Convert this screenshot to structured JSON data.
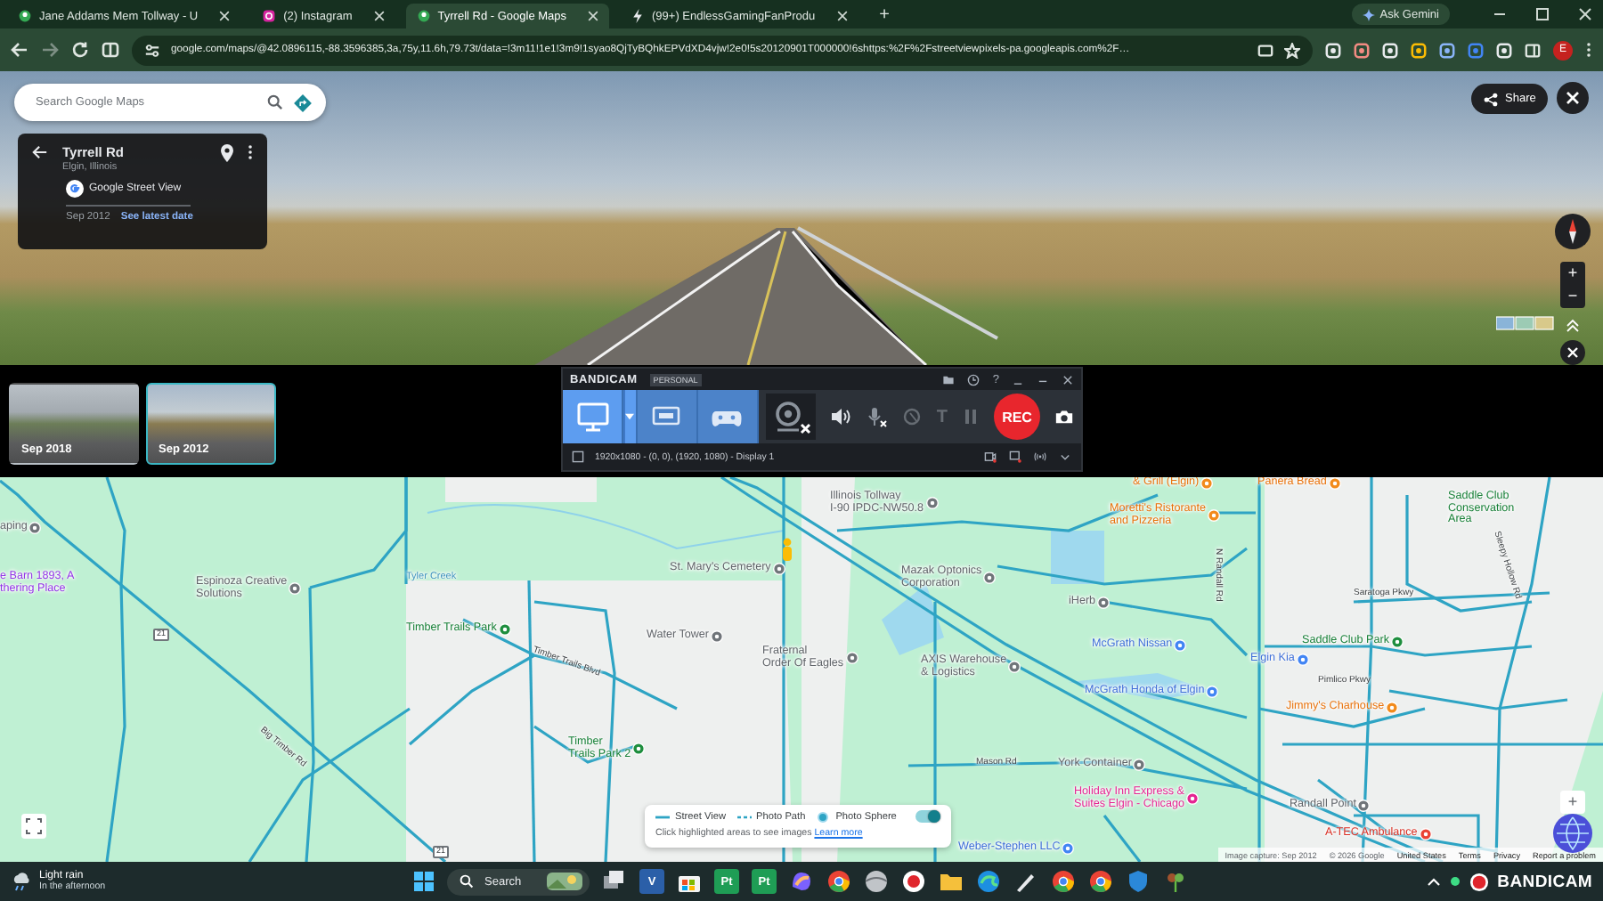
{
  "browser": {
    "tabs": [
      {
        "title": "Jane Addams Mem Tollway - U",
        "kind": "maps",
        "selected": false
      },
      {
        "title": "(2) Instagram",
        "kind": "instagram",
        "selected": false
      },
      {
        "title": "Tyrrell Rd - Google Maps",
        "kind": "maps",
        "selected": true
      },
      {
        "title": "(99+) EndlessGamingFanProdu",
        "kind": "bolt",
        "selected": false
      }
    ],
    "new_tab": "+",
    "gemini": "Ask Gemini",
    "url": "google.com/maps/@42.0896115,-88.3596385,3a,75y,11.6h,79.73t/data=!3m11!1e1!3m9!1syao8QjTyBQhkEPVdXD4vjw!2e0!5s20120901T000000!6shttps:%2F%2Fstreetviewpixels-pa.googleapis.com%2F…",
    "profile": "E"
  },
  "street_view": {
    "search": {
      "placeholder": "Search Google Maps"
    },
    "card": {
      "title": "Tyrrell Rd",
      "subtitle": "Elgin, Illinois",
      "source": "Google Street View",
      "date": "Sep 2012",
      "link": "See latest date"
    },
    "share": "Share",
    "zoom": [
      "+",
      "−"
    ],
    "timeline": [
      {
        "date": "Sep 2018",
        "selected": false
      },
      {
        "date": "Sep 2012",
        "selected": true
      }
    ]
  },
  "bandicam": {
    "brand": "BANDICAM",
    "edition": "PERSONAL",
    "help": "?",
    "modes": [
      {
        "kind": "screen",
        "selected": true
      },
      {
        "kind": "device",
        "selected": false
      },
      {
        "kind": "game",
        "selected": false
      }
    ],
    "text_tool": "T",
    "rec": "REC",
    "area": "1920x1080 - (0, 0), (1920, 1080) - Display 1"
  },
  "map": {
    "labels": [
      {
        "text": "aping",
        "kind": "place"
      },
      {
        "text": "e Barn 1893, A\nthering Place",
        "kind": "venue"
      },
      {
        "text": "Espinoza Creative\nSolutions",
        "kind": "place"
      },
      {
        "text": "Tyler Creek",
        "kind": "water"
      },
      {
        "text": "Timber Trails Park",
        "kind": "park"
      },
      {
        "text": "St. Mary's Cemetery",
        "kind": "place"
      },
      {
        "text": "Water Tower",
        "kind": "place"
      },
      {
        "text": "Fraternal\nOrder Of Eagles",
        "kind": "place"
      },
      {
        "text": "Timber\nTrails Park 2",
        "kind": "park"
      },
      {
        "text": "Illinois Tollway\nI-90 IPDC-NW50.8",
        "kind": "place"
      },
      {
        "text": "& Grill (Elgin)",
        "kind": "food"
      },
      {
        "text": "Panera Bread",
        "kind": "food"
      },
      {
        "text": "Moretti's Ristorante\nand Pizzeria",
        "kind": "food"
      },
      {
        "text": "Saddle Club\nConservation\nArea",
        "kind": "parkarea"
      },
      {
        "text": "Mazak Optonics\nCorporation",
        "kind": "place"
      },
      {
        "text": "iHerb",
        "kind": "place"
      },
      {
        "text": "McGrath Nissan",
        "kind": "auto"
      },
      {
        "text": "Saddle Club Park",
        "kind": "park"
      },
      {
        "text": "AXIS Warehouse\n& Logistics",
        "kind": "place"
      },
      {
        "text": "Elgin Kia",
        "kind": "auto"
      },
      {
        "text": "McGrath Honda of Elgin",
        "kind": "auto"
      },
      {
        "text": "Jimmy's Charhouse",
        "kind": "food"
      },
      {
        "text": "York Container",
        "kind": "place"
      },
      {
        "text": "Holiday Inn Express &\nSuites Elgin - Chicago",
        "kind": "hotel"
      },
      {
        "text": "Randall Point",
        "kind": "place"
      },
      {
        "text": "A-TEC Ambulance",
        "kind": "hospital"
      },
      {
        "text": "Big Timber Rd",
        "kind": "street"
      },
      {
        "text": "Mason Rd",
        "kind": "street"
      },
      {
        "text": "N Randall Rd",
        "kind": "street"
      },
      {
        "text": "Pimlico Pkwy",
        "kind": "street"
      },
      {
        "text": "Sleepy Hollow Rd",
        "kind": "street"
      },
      {
        "text": "Saratoga Pkwy",
        "kind": "street"
      },
      {
        "text": "Timber Trails Blvd",
        "kind": "street"
      },
      {
        "text": "21",
        "kind": "shield"
      },
      {
        "text": "21",
        "kind": "shield"
      },
      {
        "text": "Weber-Stephen LLC",
        "kind": "auto"
      }
    ],
    "legend": {
      "items": [
        {
          "label": "Street View",
          "kind": "line"
        },
        {
          "label": "Photo Path",
          "kind": "dashed"
        },
        {
          "label": "Photo Sphere",
          "kind": "dot"
        }
      ],
      "toggle_on": true,
      "hint": "Click highlighted areas to see images",
      "link": "Learn more"
    },
    "zoom": "+",
    "attribution": [
      {
        "text": "Image capture: Sep 2012",
        "link": false
      },
      {
        "text": "© 2026 Google",
        "link": false
      },
      {
        "text": "United States",
        "link": true
      },
      {
        "text": "Terms",
        "link": true
      },
      {
        "text": "Privacy",
        "link": true
      },
      {
        "text": "Report a problem",
        "link": true
      }
    ]
  },
  "taskbar": {
    "weather": {
      "title": "Light rain",
      "subtitle": "In the afternoon"
    },
    "search": {
      "placeholder": "Search"
    },
    "apps": [
      {
        "kind": "task-view"
      },
      {
        "kind": "letter",
        "label": "V",
        "color": "#2b5fa8"
      },
      {
        "kind": "store"
      },
      {
        "kind": "letter",
        "label": "Pt",
        "color": "#1f9d55"
      },
      {
        "kind": "letter",
        "label": "Pt",
        "color": "#1f9d55"
      },
      {
        "kind": "copilot"
      },
      {
        "kind": "chrome"
      },
      {
        "kind": "sphere"
      },
      {
        "kind": "record"
      },
      {
        "kind": "folder"
      },
      {
        "kind": "edge"
      },
      {
        "kind": "pen"
      },
      {
        "kind": "chrome"
      },
      {
        "kind": "chrome"
      },
      {
        "kind": "shield"
      },
      {
        "kind": "plant"
      }
    ],
    "tray_app": "BANDICAM"
  }
}
